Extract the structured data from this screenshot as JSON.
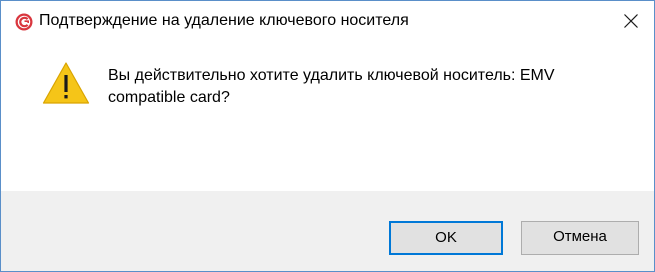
{
  "window": {
    "title": "Подтверждение на удаление ключевого носителя",
    "app_icon": "cryptopro-app-icon",
    "close_icon": "close-icon"
  },
  "dialog": {
    "icon": "warning-icon",
    "message": "Вы действительно хотите удалить ключевой носитель: EMV compatible card?"
  },
  "buttons": {
    "ok_label": "OK",
    "cancel_label": "Отмена"
  },
  "colors": {
    "accent": "#0078d7",
    "warning": "#f5c518",
    "app_icon": "#d9363e",
    "footer_bg": "#f0f0f0"
  }
}
